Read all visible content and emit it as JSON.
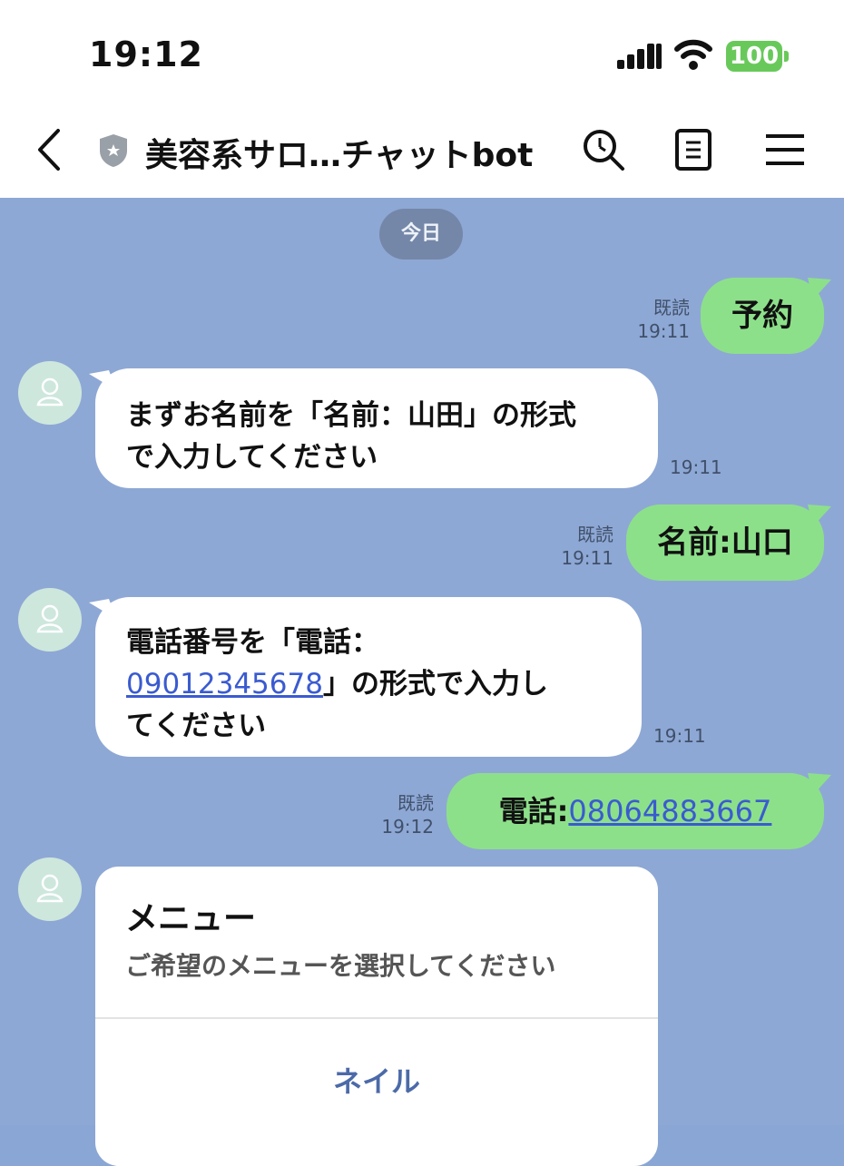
{
  "status": {
    "time": "19:12",
    "battery": "100"
  },
  "header": {
    "title": "美容系サロ…チャットbot"
  },
  "chat": {
    "date_pill": "今日",
    "messages": [
      {
        "from": "me",
        "text": "予約",
        "read": "既読",
        "time": "19:11"
      },
      {
        "from": "bot",
        "line1": "まずお名前を「名前：山田」の形式",
        "line2": "で入力してください",
        "time": "19:11"
      },
      {
        "from": "me",
        "text": "名前:山口",
        "read": "既読",
        "time": "19:11"
      },
      {
        "from": "bot",
        "line1": "電話番号を「電話：",
        "link": "09012345678",
        "line2_rest": "」の形式で入力し",
        "line3": "てください",
        "time": "19:11"
      },
      {
        "from": "me",
        "prefix": "電話:",
        "link": "08064883667",
        "read": "既読",
        "time": "19:12"
      }
    ],
    "card": {
      "title": "メニュー",
      "subtitle": "ご希望のメニューを選択してください",
      "button": "ネイル"
    }
  }
}
